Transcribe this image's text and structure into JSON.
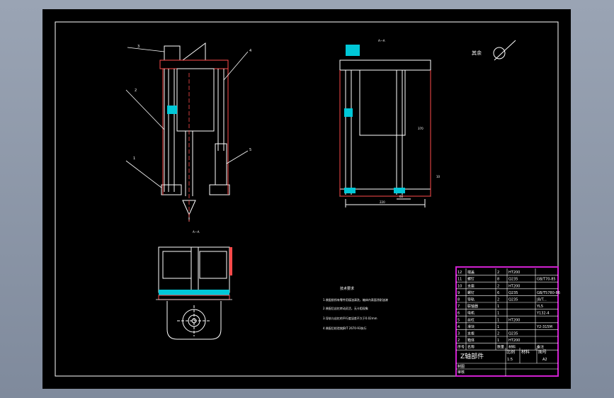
{
  "drawing": {
    "section_label_top": "A—A",
    "section_label_bottom": "A—A",
    "roughness_label": "其余",
    "tech_title": "技术要求",
    "tech_notes": [
      "1.装配前所有零件用煤油清洗，箱体内表面涂耐油漆",
      "2.装配后丝杠转动灵活，无卡阻现象",
      "3.导轨与丝杠的平行度误差不大于0.02mm",
      "4.装配后检验按JB/T 2670-93执行"
    ],
    "dims": {
      "width": "220",
      "height_right": "370",
      "slot": "60"
    },
    "callouts_left": [
      "1",
      "2",
      "3",
      "4",
      "5"
    ],
    "callout_right": "10"
  },
  "title_block": {
    "rows": [
      {
        "no": "12",
        "name": "端盖",
        "qty": "2",
        "mat": "HT200",
        "std": ""
      },
      {
        "no": "11",
        "name": "螺钉",
        "qty": "8",
        "mat": "Q235",
        "std": "GB/T70-85"
      },
      {
        "no": "10",
        "name": "支座",
        "qty": "2",
        "mat": "HT200",
        "std": ""
      },
      {
        "no": "9",
        "name": "螺钉",
        "qty": "6",
        "mat": "Q235",
        "std": "GB/T5780-86"
      },
      {
        "no": "8",
        "name": "导轨",
        "qty": "2",
        "mat": "Q235",
        "std": "JB/T..."
      },
      {
        "no": "7",
        "name": "联轴器",
        "qty": "1",
        "mat": "",
        "std": "YL5"
      },
      {
        "no": "6",
        "name": "电机",
        "qty": "1",
        "mat": "",
        "std": "Y132-4"
      },
      {
        "no": "5",
        "name": "丝杠",
        "qty": "1",
        "mat": "HT200",
        "std": ""
      },
      {
        "no": "4",
        "name": "滑块",
        "qty": "1",
        "mat": "",
        "std": "Y2-315M"
      },
      {
        "no": "3",
        "name": "支板",
        "qty": "2",
        "mat": "Q235",
        "std": ""
      },
      {
        "no": "2",
        "name": "箱体",
        "qty": "1",
        "mat": "HT200",
        "std": ""
      }
    ],
    "header": [
      "序号",
      "名称",
      "数量",
      "材料",
      "备注"
    ],
    "part_title": "Z轴部件",
    "labels": {
      "scale": "比例",
      "material": "材料",
      "drawing_no": "图号",
      "design": "制图",
      "review": "审核"
    },
    "scale_value": "1:5",
    "sheet_value": "A2"
  }
}
